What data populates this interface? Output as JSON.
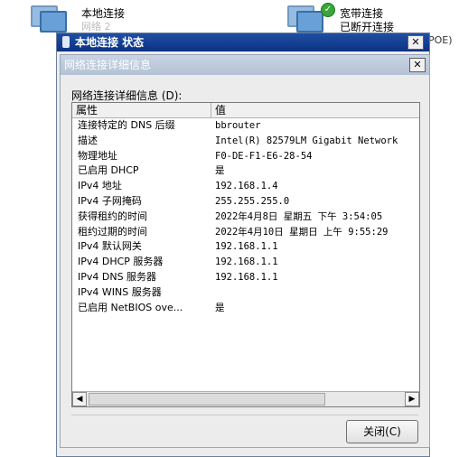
{
  "background": {
    "local_connection": {
      "title": "本地连接",
      "subtitle": "网络 2"
    },
    "broadband_connection": {
      "title": "宽带连接",
      "subtitle": "已断开连接"
    },
    "trailing_text": "POE)"
  },
  "outer_dialog": {
    "title": "本地连接 状态",
    "close_glyph": "✕"
  },
  "inner_dialog": {
    "title": "网络连接详细信息",
    "close_glyph": "✕",
    "group_label": "网络连接详细信息 (D):",
    "columns": {
      "property": "属性",
      "value": "值"
    },
    "rows": [
      {
        "property": "连接特定的 DNS 后缀",
        "value": "bbrouter"
      },
      {
        "property": "描述",
        "value": "Intel(R) 82579LM Gigabit Network"
      },
      {
        "property": "物理地址",
        "value": "F0-DE-F1-E6-28-54"
      },
      {
        "property": "已启用 DHCP",
        "value": "是"
      },
      {
        "property": "IPv4 地址",
        "value": "192.168.1.4"
      },
      {
        "property": "IPv4 子网掩码",
        "value": "255.255.255.0"
      },
      {
        "property": "获得租约的时间",
        "value": "2022年4月8日 星期五 下午 3:54:05"
      },
      {
        "property": "租约过期的时间",
        "value": "2022年4月10日 星期日 上午 9:55:29"
      },
      {
        "property": "IPv4 默认网关",
        "value": "192.168.1.1"
      },
      {
        "property": "IPv4 DHCP 服务器",
        "value": "192.168.1.1"
      },
      {
        "property": "IPv4 DNS 服务器",
        "value": "192.168.1.1"
      },
      {
        "property": "IPv4 WINS 服务器",
        "value": ""
      },
      {
        "property": "已启用 NetBIOS ove...",
        "value": "是"
      }
    ],
    "scroll_left_glyph": "◀",
    "scroll_right_glyph": "▶",
    "close_button_label": "关闭(C)"
  }
}
